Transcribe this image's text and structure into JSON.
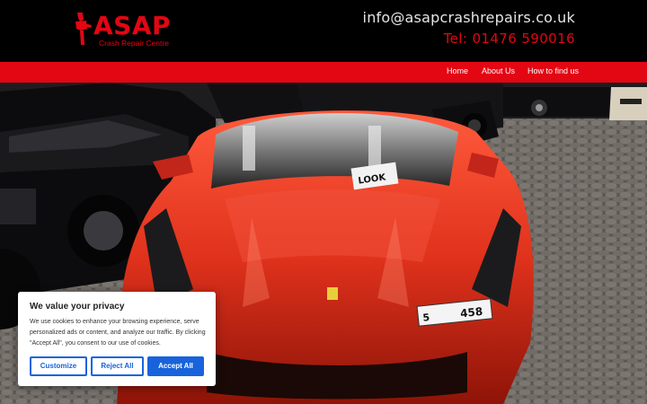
{
  "header": {
    "logo_word": "ASAP",
    "logo_subtitle": "Crash Repair Centre",
    "email": "info@asapcrashrepairs.co.uk",
    "phone": "Tel: 01476 590016"
  },
  "nav": {
    "items": [
      {
        "label": "Home"
      },
      {
        "label": "About Us"
      },
      {
        "label": "How to find us"
      }
    ]
  },
  "hero": {
    "plate_number": "458",
    "plate_left": "5",
    "windshield_sign": "LOOK"
  },
  "cookie_banner": {
    "title": "We value your privacy",
    "text": "We use cookies to enhance your browsing experience, serve personalized ads or content, and analyze our traffic. By clicking \"Accept All\", you consent to our use of cookies.",
    "customize_label": "Customize",
    "reject_label": "Reject All",
    "accept_label": "Accept All"
  },
  "colors": {
    "brand_red": "#e30613",
    "header_bg": "#000000",
    "accent_blue": "#1863dc"
  }
}
